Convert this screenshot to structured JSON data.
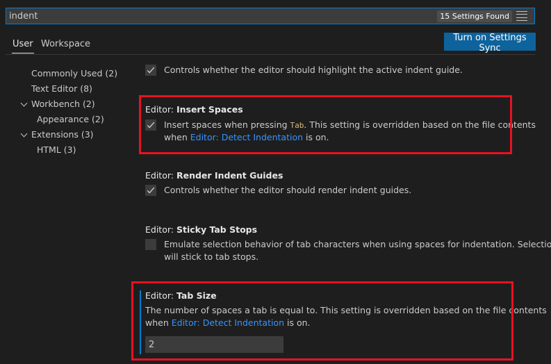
{
  "search": {
    "value": "indent",
    "results_badge": "15 Settings Found"
  },
  "tabs": [
    {
      "label": "User"
    },
    {
      "label": "Workspace"
    }
  ],
  "sync_button": "Turn on Settings Sync",
  "toc": [
    {
      "label": "Commonly Used (2)"
    },
    {
      "label": "Text Editor (8)"
    },
    {
      "label": "Workbench (2)"
    },
    {
      "label": "Appearance (2)"
    },
    {
      "label": "Extensions (3)"
    },
    {
      "label": "HTML (3)"
    }
  ],
  "settings": {
    "highlight_active_indent": {
      "checked": true,
      "description": "Controls whether the editor should highlight the active indent guide."
    },
    "insert_spaces": {
      "prefix": "Editor: ",
      "name": "Insert Spaces",
      "checked": true,
      "desc_before": "Insert spaces when pressing ",
      "desc_code": "Tab",
      "desc_after": ". This setting is overridden based on the file contents",
      "desc_line2_before": "when ",
      "link": "Editor: Detect Indentation",
      "desc_line2_after": " is on."
    },
    "render_indent_guides": {
      "prefix": "Editor: ",
      "name": "Render Indent Guides",
      "checked": true,
      "description": "Controls whether the editor should render indent guides."
    },
    "sticky_tab_stops": {
      "prefix": "Editor: ",
      "name": "Sticky Tab Stops",
      "checked": false,
      "desc_line1": "Emulate selection behavior of tab characters when using spaces for indentation. Selection",
      "desc_line2": "will stick to tab stops."
    },
    "tab_size": {
      "prefix": "Editor: ",
      "name": "Tab Size",
      "desc_line1": "The number of spaces a tab is equal to. This setting is overridden based on the file contents",
      "desc_line2_before": "when ",
      "link": "Editor: Detect Indentation",
      "desc_line2_after": " is on.",
      "value": "2"
    }
  },
  "colors": {
    "highlight_border": "#e81123",
    "accent": "#0e639c",
    "link": "#3794ff"
  }
}
